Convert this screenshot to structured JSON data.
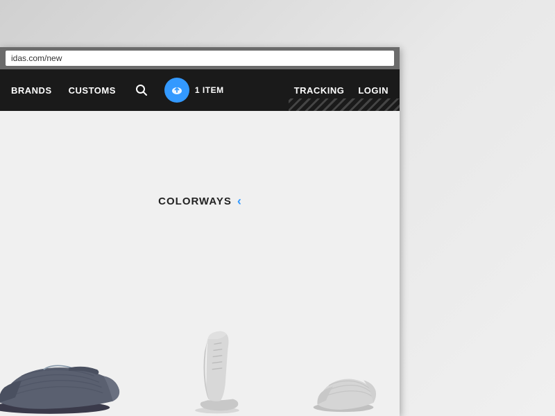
{
  "desktop": {
    "bg_color": "#d8d8d8"
  },
  "browser": {
    "address_bar_value": "idas.com/new",
    "toolbar_bg": "#6b6b6b"
  },
  "nav": {
    "brands_label": "BRANDS",
    "customs_label": "CUSTOMS",
    "cart_count_label": "1 ITEM",
    "tracking_label": "TRACKING",
    "login_label": "LOGIN",
    "bg_color": "#1a1a1a"
  },
  "main": {
    "colorways_label": "COLORWAYS",
    "colorways_chevron": "‹",
    "bg_color": "#f0f0f0"
  },
  "shoes": [
    {
      "id": "shoe-left",
      "color": "dark-blue-grey"
    },
    {
      "id": "shoe-middle",
      "color": "light-grey"
    },
    {
      "id": "shoe-right",
      "color": "light-grey"
    }
  ]
}
